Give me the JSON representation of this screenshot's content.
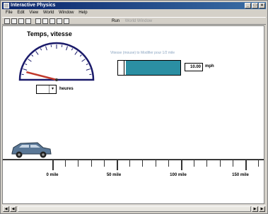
{
  "window": {
    "title": "Interactive Physics"
  },
  "menu": [
    "File",
    "Edit",
    "View",
    "World",
    "Window",
    "Help"
  ],
  "toolbar": {
    "run_label": "Run",
    "right_label": "World Window"
  },
  "scene": {
    "title": "Temps, vitesse",
    "meter_caption": "Vitesse (mouse) to Modifier pour 1/2 mile",
    "speed_value": "10.00",
    "speed_unit": "mph",
    "hours_label": "heures",
    "hours_value": "",
    "gauge_needle_fraction": 0.08,
    "meter_fill_fraction": 0.88,
    "road_labels": [
      "0 mile",
      "50 mile",
      "100 mile",
      "150 mile"
    ],
    "colors": {
      "meter": "#2b8fa3",
      "needle": "#c0392b",
      "car": "#5a7796"
    }
  }
}
